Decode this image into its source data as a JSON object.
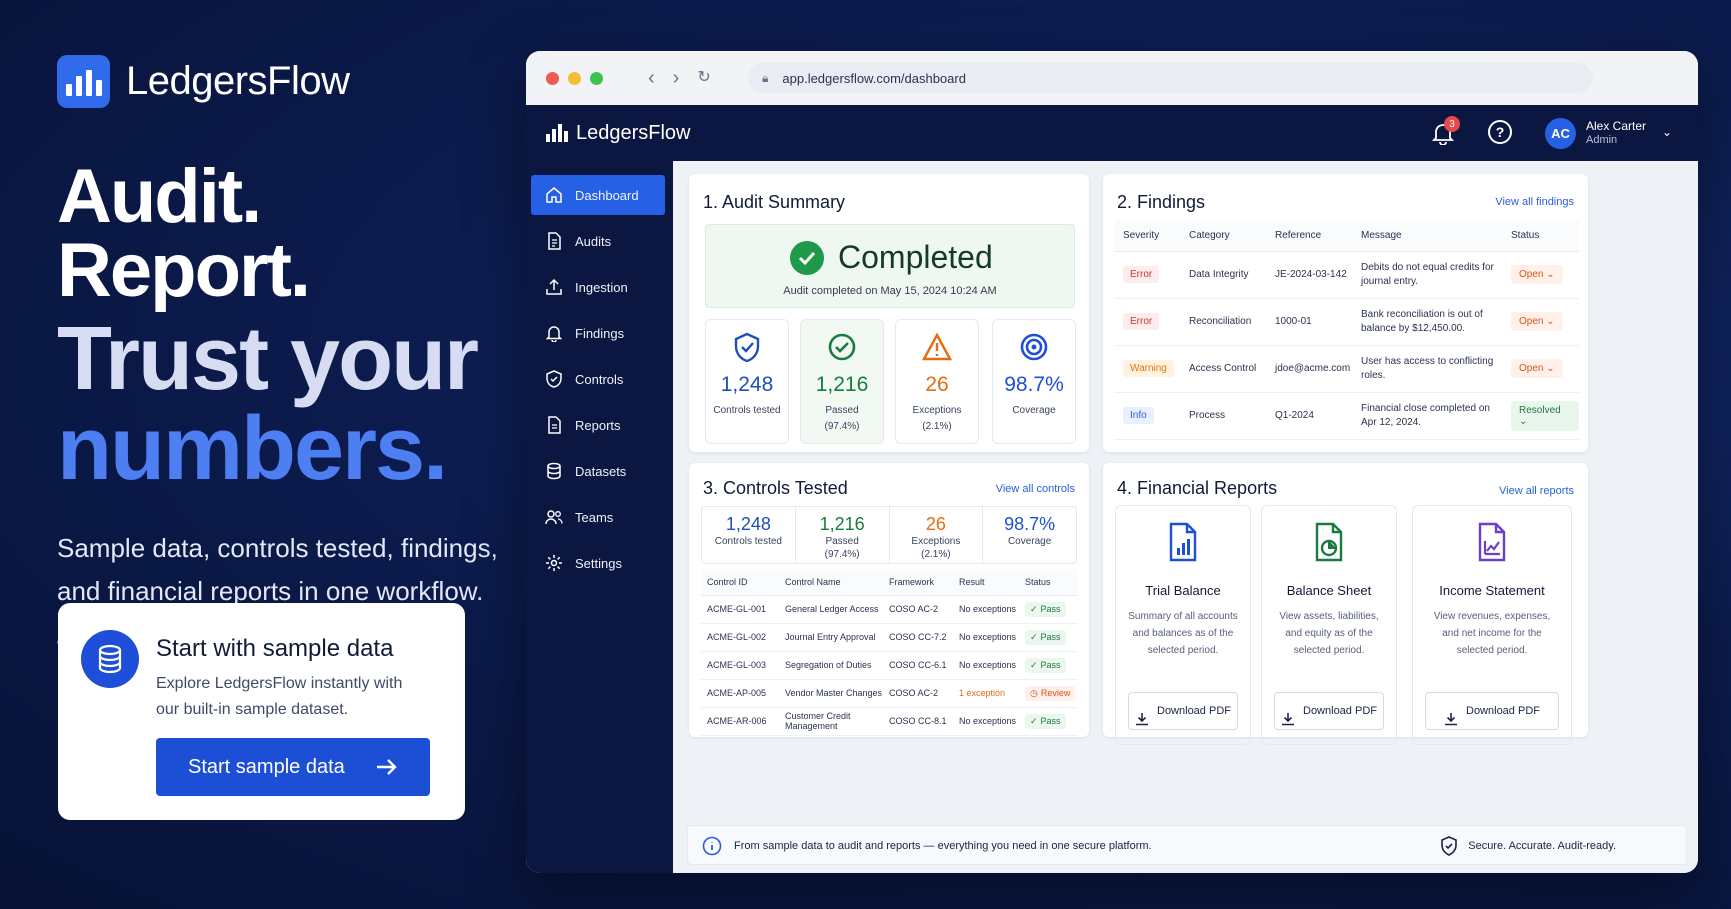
{
  "brand": {
    "name": "LedgersFlow"
  },
  "hero": {
    "line1": "Audit. Report.",
    "line2": "Trust your",
    "line3": "numbers.",
    "subhead": "Sample data, controls tested, findings, and financial reports in one workflow."
  },
  "sample": {
    "title": "Start with sample data",
    "description": "Explore LedgersFlow instantly with our built-in sample dataset.",
    "button": "Start sample data"
  },
  "browser": {
    "url": "app.ledgersflow.com/dashboard"
  },
  "app": {
    "brand": "LedgersFlow",
    "notifications": "3",
    "user": {
      "initials": "AC",
      "name": "Alex Carter",
      "role": "Admin"
    }
  },
  "sidebar": [
    {
      "label": "Dashboard",
      "icon": "home-icon",
      "active": true
    },
    {
      "label": "Audits",
      "icon": "document-icon"
    },
    {
      "label": "Ingestion",
      "icon": "upload-icon"
    },
    {
      "label": "Findings",
      "icon": "bell-icon"
    },
    {
      "label": "Controls",
      "icon": "shield-icon"
    },
    {
      "label": "Reports",
      "icon": "report-icon"
    },
    {
      "label": "Datasets",
      "icon": "database-icon"
    },
    {
      "label": "Teams",
      "icon": "users-icon"
    },
    {
      "label": "Settings",
      "icon": "gear-icon"
    }
  ],
  "audit_summary": {
    "title": "1. Audit Summary",
    "status": "Completed",
    "completed_text": "Audit completed on May 15, 2024 10:24 AM",
    "kpis": [
      {
        "value": "1,248",
        "label": "Controls tested",
        "sub": "",
        "color": "#1f4fb8"
      },
      {
        "value": "1,216",
        "label": "Passed",
        "sub": "(97.4%)",
        "color": "#1a7a3f"
      },
      {
        "value": "26",
        "label": "Exceptions",
        "sub": "(2.1%)",
        "color": "#e36b14"
      },
      {
        "value": "98.7%",
        "label": "Coverage",
        "sub": "",
        "color": "#1f4fd8"
      }
    ]
  },
  "findings": {
    "title": "2. Findings",
    "link": "View all findings",
    "headers": [
      "Severity",
      "Category",
      "Reference",
      "Message",
      "Status"
    ],
    "rows": [
      {
        "severity": "Error",
        "sev_class": "sev-err",
        "category": "Data Integrity",
        "reference": "JE-2024-03-142",
        "message": "Debits do not equal credits for journal entry.",
        "status": "Open",
        "st_class": "st-open"
      },
      {
        "severity": "Error",
        "sev_class": "sev-err",
        "category": "Reconciliation",
        "reference": "1000-01",
        "message": "Bank reconciliation is out of balance by $12,450.00.",
        "status": "Open",
        "st_class": "st-open"
      },
      {
        "severity": "Warning",
        "sev_class": "sev-warn",
        "category": "Access Control",
        "reference": "jdoe@acme.com",
        "message": "User has access to conflicting roles.",
        "status": "Open",
        "st_class": "st-open"
      },
      {
        "severity": "Info",
        "sev_class": "sev-info",
        "category": "Process",
        "reference": "Q1-2024",
        "message": "Financial close completed on Apr 12, 2024.",
        "status": "Resolved",
        "st_class": "st-res"
      }
    ]
  },
  "controls": {
    "title": "3. Controls Tested",
    "link": "View all controls",
    "summary": [
      {
        "value": "1,248",
        "label": "Controls tested",
        "sub": "",
        "color": "#1f4fb8"
      },
      {
        "value": "1,216",
        "label": "Passed",
        "sub": "(97.4%)",
        "color": "#1a7a3f"
      },
      {
        "value": "26",
        "label": "Exceptions",
        "sub": "(2.1%)",
        "color": "#e36b14"
      },
      {
        "value": "98.7%",
        "label": "Coverage",
        "sub": "",
        "color": "#1f4fd8"
      }
    ],
    "headers": [
      "Control ID",
      "Control Name",
      "Framework",
      "Result",
      "Status"
    ],
    "rows": [
      {
        "id": "ACME-GL-001",
        "name": "General Ledger Access",
        "framework": "COSO AC-2",
        "result": "No exceptions",
        "status": "Pass",
        "review": false
      },
      {
        "id": "ACME-GL-002",
        "name": "Journal Entry Approval",
        "framework": "COSO CC-7.2",
        "result": "No exceptions",
        "status": "Pass",
        "review": false
      },
      {
        "id": "ACME-GL-003",
        "name": "Segregation of Duties",
        "framework": "COSO CC-6.1",
        "result": "No exceptions",
        "status": "Pass",
        "review": false
      },
      {
        "id": "ACME-AP-005",
        "name": "Vendor Master Changes",
        "framework": "COSO AC-2",
        "result": "1 exception",
        "status": "Review",
        "review": true
      },
      {
        "id": "ACME-AR-006",
        "name": "Customer Credit Management",
        "framework": "COSO CC-8.1",
        "result": "No exceptions",
        "status": "Pass",
        "review": false
      }
    ]
  },
  "reports": {
    "title": "4. Financial Reports",
    "link": "View all reports",
    "cards": [
      {
        "title": "Trial Balance",
        "description": "Summary of all accounts and balances as of the selected period.",
        "button": "Download PDF",
        "color": "#1f4fd8",
        "icon": "trial-balance-icon"
      },
      {
        "title": "Balance Sheet",
        "description": "View assets, liabilities, and equity as of the selected period.",
        "button": "Download PDF",
        "color": "#1a7a3f",
        "icon": "balance-sheet-icon"
      },
      {
        "title": "Income Statement",
        "description": "View revenues, expenses, and net income for the selected period.",
        "button": "Download PDF",
        "color": "#6a3fc9",
        "icon": "income-statement-icon"
      }
    ]
  },
  "footer": {
    "left": "From sample data to audit and reports — everything you need in one secure platform.",
    "right": "Secure. Accurate. Audit-ready."
  }
}
